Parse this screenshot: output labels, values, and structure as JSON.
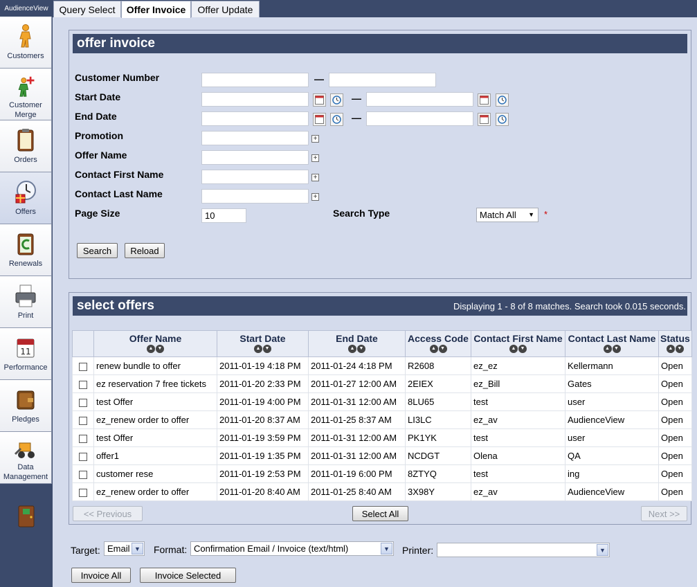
{
  "app": {
    "brand": "AudienceView"
  },
  "tabs": [
    {
      "label": "Query Select"
    },
    {
      "label": "Offer Invoice"
    },
    {
      "label": "Offer Update"
    }
  ],
  "sidebar": {
    "items": [
      {
        "label": "Customers",
        "icon": "person-icon"
      },
      {
        "label": "Customer Merge",
        "icon": "merge-icon"
      },
      {
        "label": "Orders",
        "icon": "clipboard-icon"
      },
      {
        "label": "Offers",
        "icon": "clock-gift-icon"
      },
      {
        "label": "Renewals",
        "icon": "renewal-icon"
      },
      {
        "label": "Print",
        "icon": "printer-icon"
      },
      {
        "label": "Performance",
        "icon": "calendar-icon"
      },
      {
        "label": "Pledges",
        "icon": "wallet-icon"
      },
      {
        "label": "Data Management",
        "icon": "loader-icon"
      }
    ]
  },
  "form": {
    "title": "offer invoice",
    "labels": {
      "customer_number": "Customer Number",
      "start_date": "Start Date",
      "end_date": "End Date",
      "promotion": "Promotion",
      "offer_name": "Offer Name",
      "contact_first": "Contact First Name",
      "contact_last": "Contact Last Name",
      "page_size": "Page Size",
      "search_type": "Search Type"
    },
    "dash": "—",
    "page_size_value": "10",
    "search_type_value": "Match All",
    "required_marker": "*",
    "search_button": "Search",
    "reload_button": "Reload"
  },
  "results": {
    "title": "select offers",
    "meta": "Displaying 1 - 8 of 8 matches. Search took 0.015 seconds.",
    "columns": [
      "Offer Name",
      "Start Date",
      "End Date",
      "Access Code",
      "Contact First Name",
      "Contact Last Name",
      "Status"
    ],
    "rows": [
      [
        "renew bundle to offer",
        "2011-01-19 4:18 PM",
        "2011-01-24 4:18 PM",
        "R2608",
        "ez_ez",
        "Kellermann",
        "Open"
      ],
      [
        "ez reservation 7 free tickets",
        "2011-01-20 2:33 PM",
        "2011-01-27 12:00 AM",
        "2EIEX",
        "ez_Bill",
        "Gates",
        "Open"
      ],
      [
        "test Offer",
        "2011-01-19 4:00 PM",
        "2011-01-31 12:00 AM",
        "8LU65",
        "test",
        "user",
        "Open"
      ],
      [
        "ez_renew order to offer",
        "2011-01-20 8:37 AM",
        "2011-01-25 8:37 AM",
        "LI3LC",
        "ez_av",
        "AudienceView",
        "Open"
      ],
      [
        "test Offer",
        "2011-01-19 3:59 PM",
        "2011-01-31 12:00 AM",
        "PK1YK",
        "test",
        "user",
        "Open"
      ],
      [
        "offer1",
        "2011-01-19 1:35 PM",
        "2011-01-31 12:00 AM",
        "NCDGT",
        "Olena",
        "QA",
        "Open"
      ],
      [
        "customer rese",
        "2011-01-19 2:53 PM",
        "2011-01-19 6:00 PM",
        "8ZTYQ",
        "test",
        "ing",
        "Open"
      ],
      [
        "ez_renew order to offer",
        "2011-01-20 8:40 AM",
        "2011-01-25 8:40 AM",
        "3X98Y",
        "ez_av",
        "AudienceView",
        "Open"
      ]
    ],
    "prev_button": "<< Previous",
    "select_all_button": "Select All",
    "next_button": "Next >>"
  },
  "footer": {
    "target_label": "Target:",
    "target_value": "Email",
    "format_label": "Format:",
    "format_value": "Confirmation Email / Invoice (text/html)",
    "printer_label": "Printer:",
    "printer_value": "",
    "invoice_all_button": "Invoice All",
    "invoice_selected_button": "Invoice Selected"
  },
  "colors": {
    "header_bg": "#3b4a6b",
    "page_bg": "#d4dbec",
    "required": "#cc0000"
  }
}
